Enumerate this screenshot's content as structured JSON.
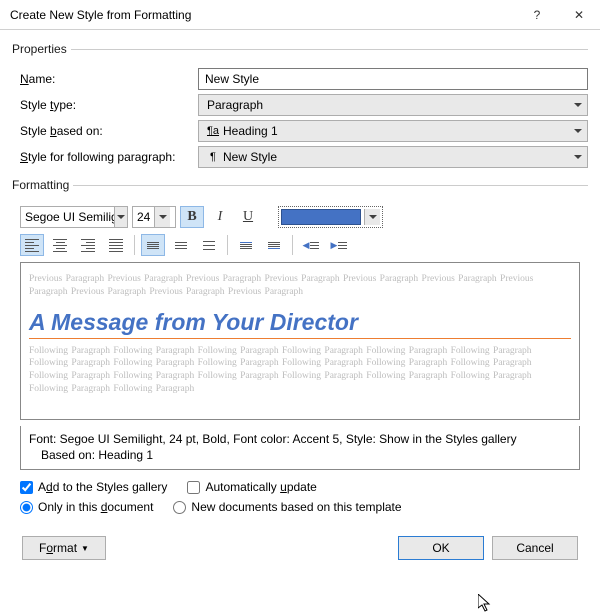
{
  "title": "Create New Style from Formatting",
  "groups": {
    "properties": "Properties",
    "formatting": "Formatting"
  },
  "properties": {
    "name_label_pre": "",
    "name_u": "N",
    "name_label_post": "ame:",
    "name_value": "New Style",
    "type_label_pre": "Style ",
    "type_u": "t",
    "type_label_post": "ype:",
    "type_value": "Paragraph",
    "based_label_pre": "Style ",
    "based_u": "b",
    "based_label_post": "ased on:",
    "based_value": "Heading 1",
    "based_icon": "¶a",
    "follow_label_pre": "",
    "follow_u": "S",
    "follow_label_post": "tyle for following paragraph:",
    "follow_value": "New Style",
    "follow_icon": "¶"
  },
  "font": {
    "name": "Segoe UI Semilight",
    "size": "24",
    "bold": "B",
    "italic": "I",
    "underline": "U",
    "color": "#4472c4"
  },
  "preview": {
    "prev_text": "Previous Paragraph Previous Paragraph Previous Paragraph Previous Paragraph Previous Paragraph Previous Paragraph Previous Paragraph Previous Paragraph Previous Paragraph Previous Paragraph",
    "sample": "A Message from Your Director",
    "next_text": "Following Paragraph Following Paragraph Following Paragraph Following Paragraph Following Paragraph Following Paragraph Following Paragraph Following Paragraph Following Paragraph Following Paragraph Following Paragraph Following Paragraph Following Paragraph Following Paragraph Following Paragraph Following Paragraph Following Paragraph Following Paragraph Following Paragraph Following Paragraph"
  },
  "description": {
    "line1": "Font: Segoe UI Semilight, 24 pt, Bold, Font color: Accent 5, Style: Show in the Styles gallery",
    "line2": "Based on: Heading 1"
  },
  "checks": {
    "add_pre": "A",
    "add_u": "d",
    "add_post": "d to the Styles gallery",
    "auto_pre": "Automatically ",
    "auto_u": "u",
    "auto_post": "pdate",
    "only_pre": "Only in this ",
    "only_u": "d",
    "only_post": "ocument",
    "tmpl_pre": "New documents based on this template"
  },
  "buttons": {
    "format_pre": "F",
    "format_u": "o",
    "format_post": "rmat",
    "ok": "OK",
    "cancel": "Cancel"
  }
}
